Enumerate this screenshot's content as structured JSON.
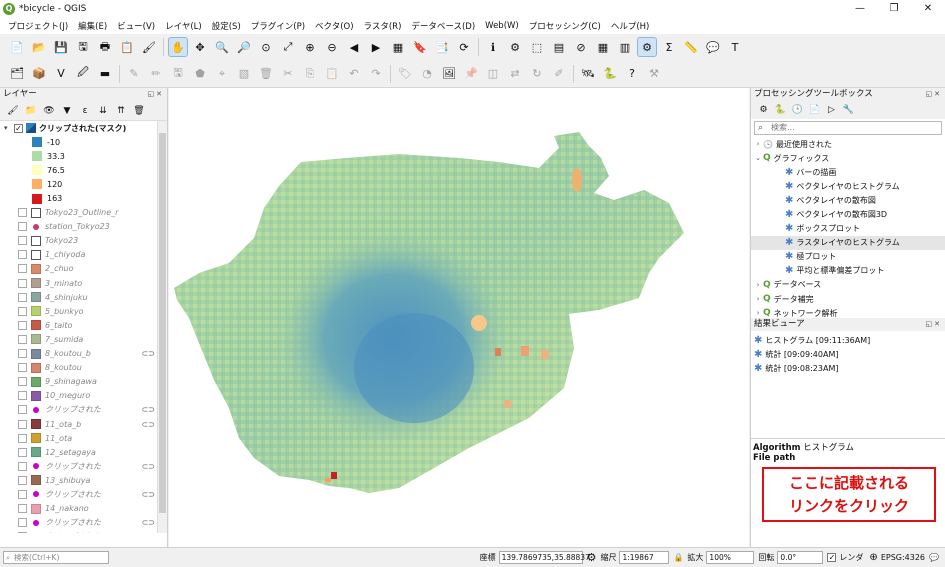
{
  "window": {
    "title": "*bicycle - QGIS",
    "minimize": "—",
    "restore": "❐",
    "close": "✕"
  },
  "menu": [
    "プロジェクト(J)",
    "編集(E)",
    "ビュー(V)",
    "レイヤ(L)",
    "設定(S)",
    "プラグイン(P)",
    "ベクタ(O)",
    "ラスタ(R)",
    "データベース(D)",
    "Web(W)",
    "プロセッシング(C)",
    "ヘルプ(H)"
  ],
  "layers_panel": {
    "title": "レイヤー",
    "active_layer": "クリップされた(マスク)",
    "legend": [
      {
        "label": "-10",
        "color": "#2b83ba"
      },
      {
        "label": "33.3",
        "color": "#abdda4"
      },
      {
        "label": "76.5",
        "color": "#ffffbf"
      },
      {
        "label": "120",
        "color": "#fdae61"
      },
      {
        "label": "163",
        "color": "#d7191c"
      }
    ],
    "layers": [
      {
        "name": "Tokyo23_Outline_r",
        "kind": "box",
        "swatch": "#ffffff"
      },
      {
        "name": "station_Tokyo23",
        "kind": "dot",
        "swatch": "#c83a6a"
      },
      {
        "name": "Tokyo23",
        "kind": "box",
        "swatch": "#ffffff"
      },
      {
        "name": "1_chiyoda",
        "kind": "box",
        "swatch": "#ffffff"
      },
      {
        "name": "2_chuo",
        "kind": "box",
        "swatch": "#d98a6a"
      },
      {
        "name": "3_minato",
        "kind": "box",
        "swatch": "#b0a090"
      },
      {
        "name": "4_shinjuku",
        "kind": "box",
        "swatch": "#8aa6a0"
      },
      {
        "name": "5_bunkyo",
        "kind": "box",
        "swatch": "#b6d26a"
      },
      {
        "name": "6_taito",
        "kind": "box",
        "swatch": "#c85a4a"
      },
      {
        "name": "7_sumida",
        "kind": "box",
        "swatch": "#a8b890"
      },
      {
        "name": "8_koutou_b",
        "kind": "box",
        "swatch": "#7a8aa0",
        "link": true
      },
      {
        "name": "8_koutou",
        "kind": "box",
        "swatch": "#d6846a"
      },
      {
        "name": "9_shinagawa",
        "kind": "box",
        "swatch": "#6aaa6a"
      },
      {
        "name": "10_meguro",
        "kind": "box",
        "swatch": "#8a5aa8"
      },
      {
        "name": "クリップされた",
        "kind": "dot",
        "swatch": "#c800c8",
        "link": true
      },
      {
        "name": "11_ota_b",
        "kind": "box",
        "swatch": "#8a3a3a",
        "link": true
      },
      {
        "name": "11_ota",
        "kind": "box",
        "swatch": "#d0a030"
      },
      {
        "name": "12_setagaya",
        "kind": "box",
        "swatch": "#6aa88a"
      },
      {
        "name": "クリップされた",
        "kind": "dot",
        "swatch": "#c800c8",
        "link": true
      },
      {
        "name": "13_shibuya",
        "kind": "box",
        "swatch": "#9a6a50"
      },
      {
        "name": "クリップされた",
        "kind": "dot",
        "swatch": "#c800c8",
        "link": true
      },
      {
        "name": "14_nakano",
        "kind": "box",
        "swatch": "#e8a0b0"
      },
      {
        "name": "クリップされた",
        "kind": "dot",
        "swatch": "#c800c8",
        "link": true
      },
      {
        "name": "クリップされた",
        "kind": "dot",
        "swatch": "#c800c8",
        "link": true
      }
    ]
  },
  "toolbox": {
    "title": "プロセッシングツールボックス",
    "search_placeholder": "検索...",
    "items": [
      {
        "label": "最近使用された",
        "level": 0,
        "arrow": "›",
        "icon": "clock"
      },
      {
        "label": "グラフィックス",
        "level": 0,
        "arrow": "⌄",
        "icon": "q"
      },
      {
        "label": "バーの描画",
        "level": 1,
        "icon": "gear"
      },
      {
        "label": "ベクタレイヤのヒストグラム",
        "level": 1,
        "icon": "gear"
      },
      {
        "label": "ベクタレイヤの散布図",
        "level": 1,
        "icon": "gear"
      },
      {
        "label": "ベクタレイヤの散布図3D",
        "level": 1,
        "icon": "gear"
      },
      {
        "label": "ボックスプロット",
        "level": 1,
        "icon": "gear"
      },
      {
        "label": "ラスタレイヤのヒストグラム",
        "level": 1,
        "icon": "gear",
        "selected": true
      },
      {
        "label": "極プロット",
        "level": 1,
        "icon": "gear"
      },
      {
        "label": "平均と標準偏差プロット",
        "level": 1,
        "icon": "gear"
      },
      {
        "label": "データベース",
        "level": 0,
        "arrow": "›",
        "icon": "q"
      },
      {
        "label": "データ補完",
        "level": 0,
        "arrow": "›",
        "icon": "q"
      },
      {
        "label": "ネットワーク解析",
        "level": 0,
        "arrow": "›",
        "icon": "q"
      }
    ]
  },
  "results": {
    "title": "結果ビューア",
    "items": [
      "ヒストグラム [09:11:36AM]",
      "統計 [09:09:40AM]",
      "統計 [09:08:23AM]"
    ]
  },
  "info": {
    "algorithm_key": "Algorithm",
    "algorithm_value": "ヒストグラム",
    "file_key": "File path"
  },
  "callout": {
    "line1": "ここに記載される",
    "line2": "リンクをクリック",
    "color": "#e01010"
  },
  "status": {
    "search_placeholder": "検索(Ctrl+K)",
    "coord_label": "座標",
    "coord_value": "139.7869735,35.88837",
    "scale_label": "縮尺",
    "scale_value": "1:19867",
    "zoom_label": "拡大",
    "zoom_value": "100%",
    "rotation_label": "回転",
    "rotation_value": "0.0°",
    "render_label": "レンダ",
    "crs": "EPSG:4326"
  }
}
